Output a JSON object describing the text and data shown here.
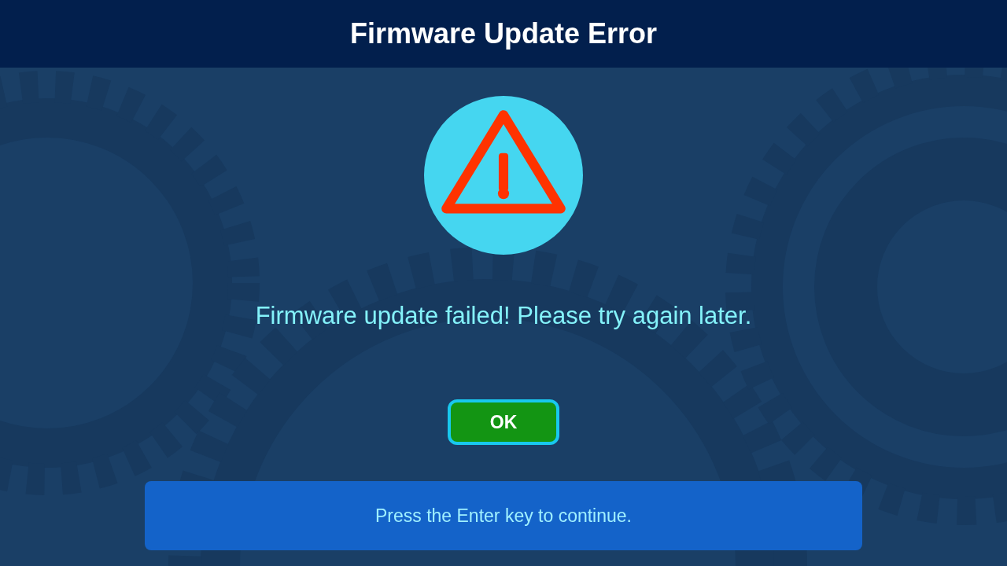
{
  "header": {
    "title": "Firmware Update Error"
  },
  "message": "Firmware update failed! Please try again later.",
  "buttons": [
    {
      "label": "OK",
      "selected": true
    }
  ],
  "footer": {
    "hint": "Press the Enter key to continue."
  }
}
